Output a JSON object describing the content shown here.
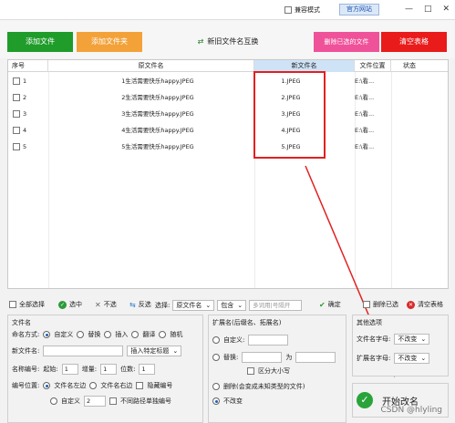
{
  "titlebar": {
    "compat_mode": "兼容模式",
    "official_site": "官方网站",
    "min": "—",
    "max": "□",
    "close": "✕"
  },
  "toolbar": {
    "add_file": "添加文件",
    "add_folder": "添加文件夹",
    "swap": "新旧文件名互换",
    "delete_selected": "删除已选的文件",
    "clear_table": "清空表格"
  },
  "table": {
    "headers": {
      "index": "序号",
      "original": "原文件名",
      "new": "新文件名",
      "location": "文件位置",
      "status": "状态"
    },
    "rows": [
      {
        "index": "1",
        "original": "1生活需要快乐happy.JPEG",
        "new": "1.JPEG",
        "location": "E:\\看..."
      },
      {
        "index": "2",
        "original": "2生活需要快乐happy.JPEG",
        "new": "2.JPEG",
        "location": "E:\\看..."
      },
      {
        "index": "3",
        "original": "3生活需要快乐happy.JPEG",
        "new": "3.JPEG",
        "location": "E:\\看..."
      },
      {
        "index": "4",
        "original": "4生活需要快乐happy.JPEG",
        "new": "4.JPEG",
        "location": "E:\\看..."
      },
      {
        "index": "5",
        "original": "5生活需要快乐happy.JPEG",
        "new": "5.JPEG",
        "location": "E:\\看..."
      }
    ]
  },
  "controls": {
    "select_all": "全部选择",
    "select": "选中",
    "deselect": "不选",
    "invert": "反选",
    "choose_label": "选择:",
    "choose_value": "原文件名",
    "contain_value": "包含",
    "multi_placeholder": "多词用|号隔开",
    "confirm": "确定",
    "delete_selected": "删除已选",
    "clear_table": "清空表格"
  },
  "filename_panel": {
    "title": "文件名",
    "mode_label": "命名方式:",
    "modes": [
      "自定义",
      "替换",
      "插入",
      "翻译",
      "随机"
    ],
    "new_name_label": "新文件名:",
    "insert_tag": "插入特定标题",
    "numbering_label": "名称编号:",
    "start_label": "起始:",
    "start_value": "1",
    "step_label": "增量:",
    "step_value": "1",
    "digits_label": "位数:",
    "digits_value": "1",
    "position_label": "编号位置:",
    "pos_left": "文件名左边",
    "pos_right": "文件名右边",
    "hide_number": "隐藏编号",
    "custom": "自定义",
    "custom_value": "2",
    "per_path": "不同路径单独编号"
  },
  "ext_panel": {
    "title": "扩展名(后缀名、拓展名)",
    "custom": "自定义:",
    "replace": "替换:",
    "as": "为",
    "case_sensitive": "区分大小写",
    "delete_option": "删除(会变成未知类型的文件)",
    "unchanged": "不改变"
  },
  "other_panel": {
    "title": "其他选项",
    "first_letter_label": "文件名字母:",
    "first_letter_value": "不改变",
    "ext_letter_label": "扩展名字母:",
    "ext_letter_value": "不改变"
  },
  "start": {
    "label": "开始改名"
  },
  "watermark": "CSDN @hlyling"
}
